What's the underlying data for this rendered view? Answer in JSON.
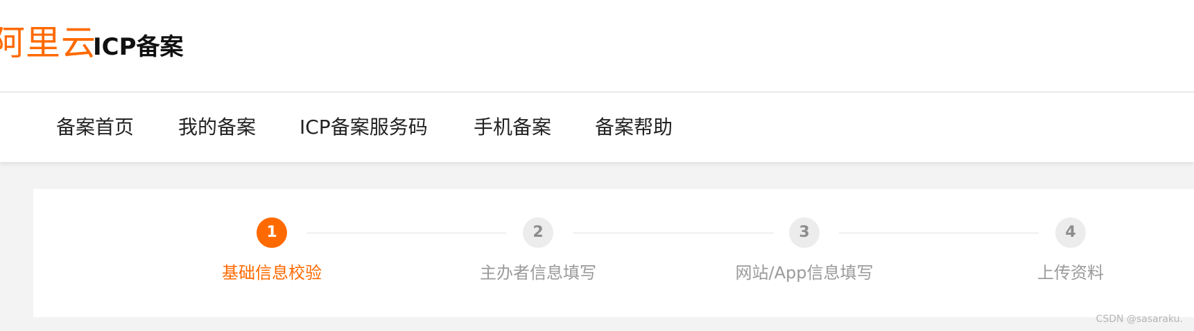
{
  "header": {
    "logo_text": "阿里云",
    "title": "ICP备案"
  },
  "nav": {
    "items": [
      {
        "label": "备案首页"
      },
      {
        "label": "我的备案"
      },
      {
        "label": "ICP备案服务码"
      },
      {
        "label": "手机备案"
      },
      {
        "label": "备案帮助"
      }
    ]
  },
  "steps": [
    {
      "number": "1",
      "label": "基础信息校验",
      "status": "active"
    },
    {
      "number": "2",
      "label": "主办者信息填写",
      "status": "pending"
    },
    {
      "number": "3",
      "label": "网站/App信息填写",
      "status": "pending"
    },
    {
      "number": "4",
      "label": "上传资料",
      "status": "pending"
    }
  ],
  "colors": {
    "brand": "#ff6a00",
    "pending": "#9a9a9a"
  },
  "watermark": "CSDN @sasaraku."
}
